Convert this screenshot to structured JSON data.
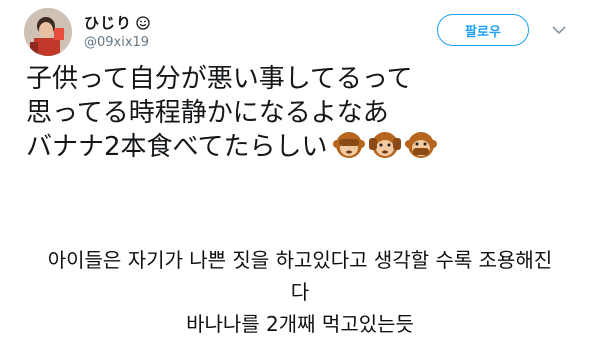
{
  "tweet": {
    "display_name": "ひじり",
    "handle": "@09xix19",
    "follow_label": "팔로우",
    "text_lines": [
      "子供って自分が悪い事してるって",
      "思ってる時程静かになるよなあ",
      "バナナ2本食べてたらしい"
    ],
    "emoji": [
      "see-no-evil-monkey",
      "hear-no-evil-monkey",
      "speak-no-evil-monkey"
    ]
  },
  "caption": {
    "lines": [
      "아이들은 자기가 나쁜 짓을 하고있다고 생각할 수록 조용해진",
      "다",
      "바나나를 2개째 먹고있는듯"
    ]
  },
  "colors": {
    "accent": "#1da1f2",
    "handle_gray": "#657786",
    "monkey_brown": "#b5651d",
    "monkey_face": "#f2c9a0"
  }
}
